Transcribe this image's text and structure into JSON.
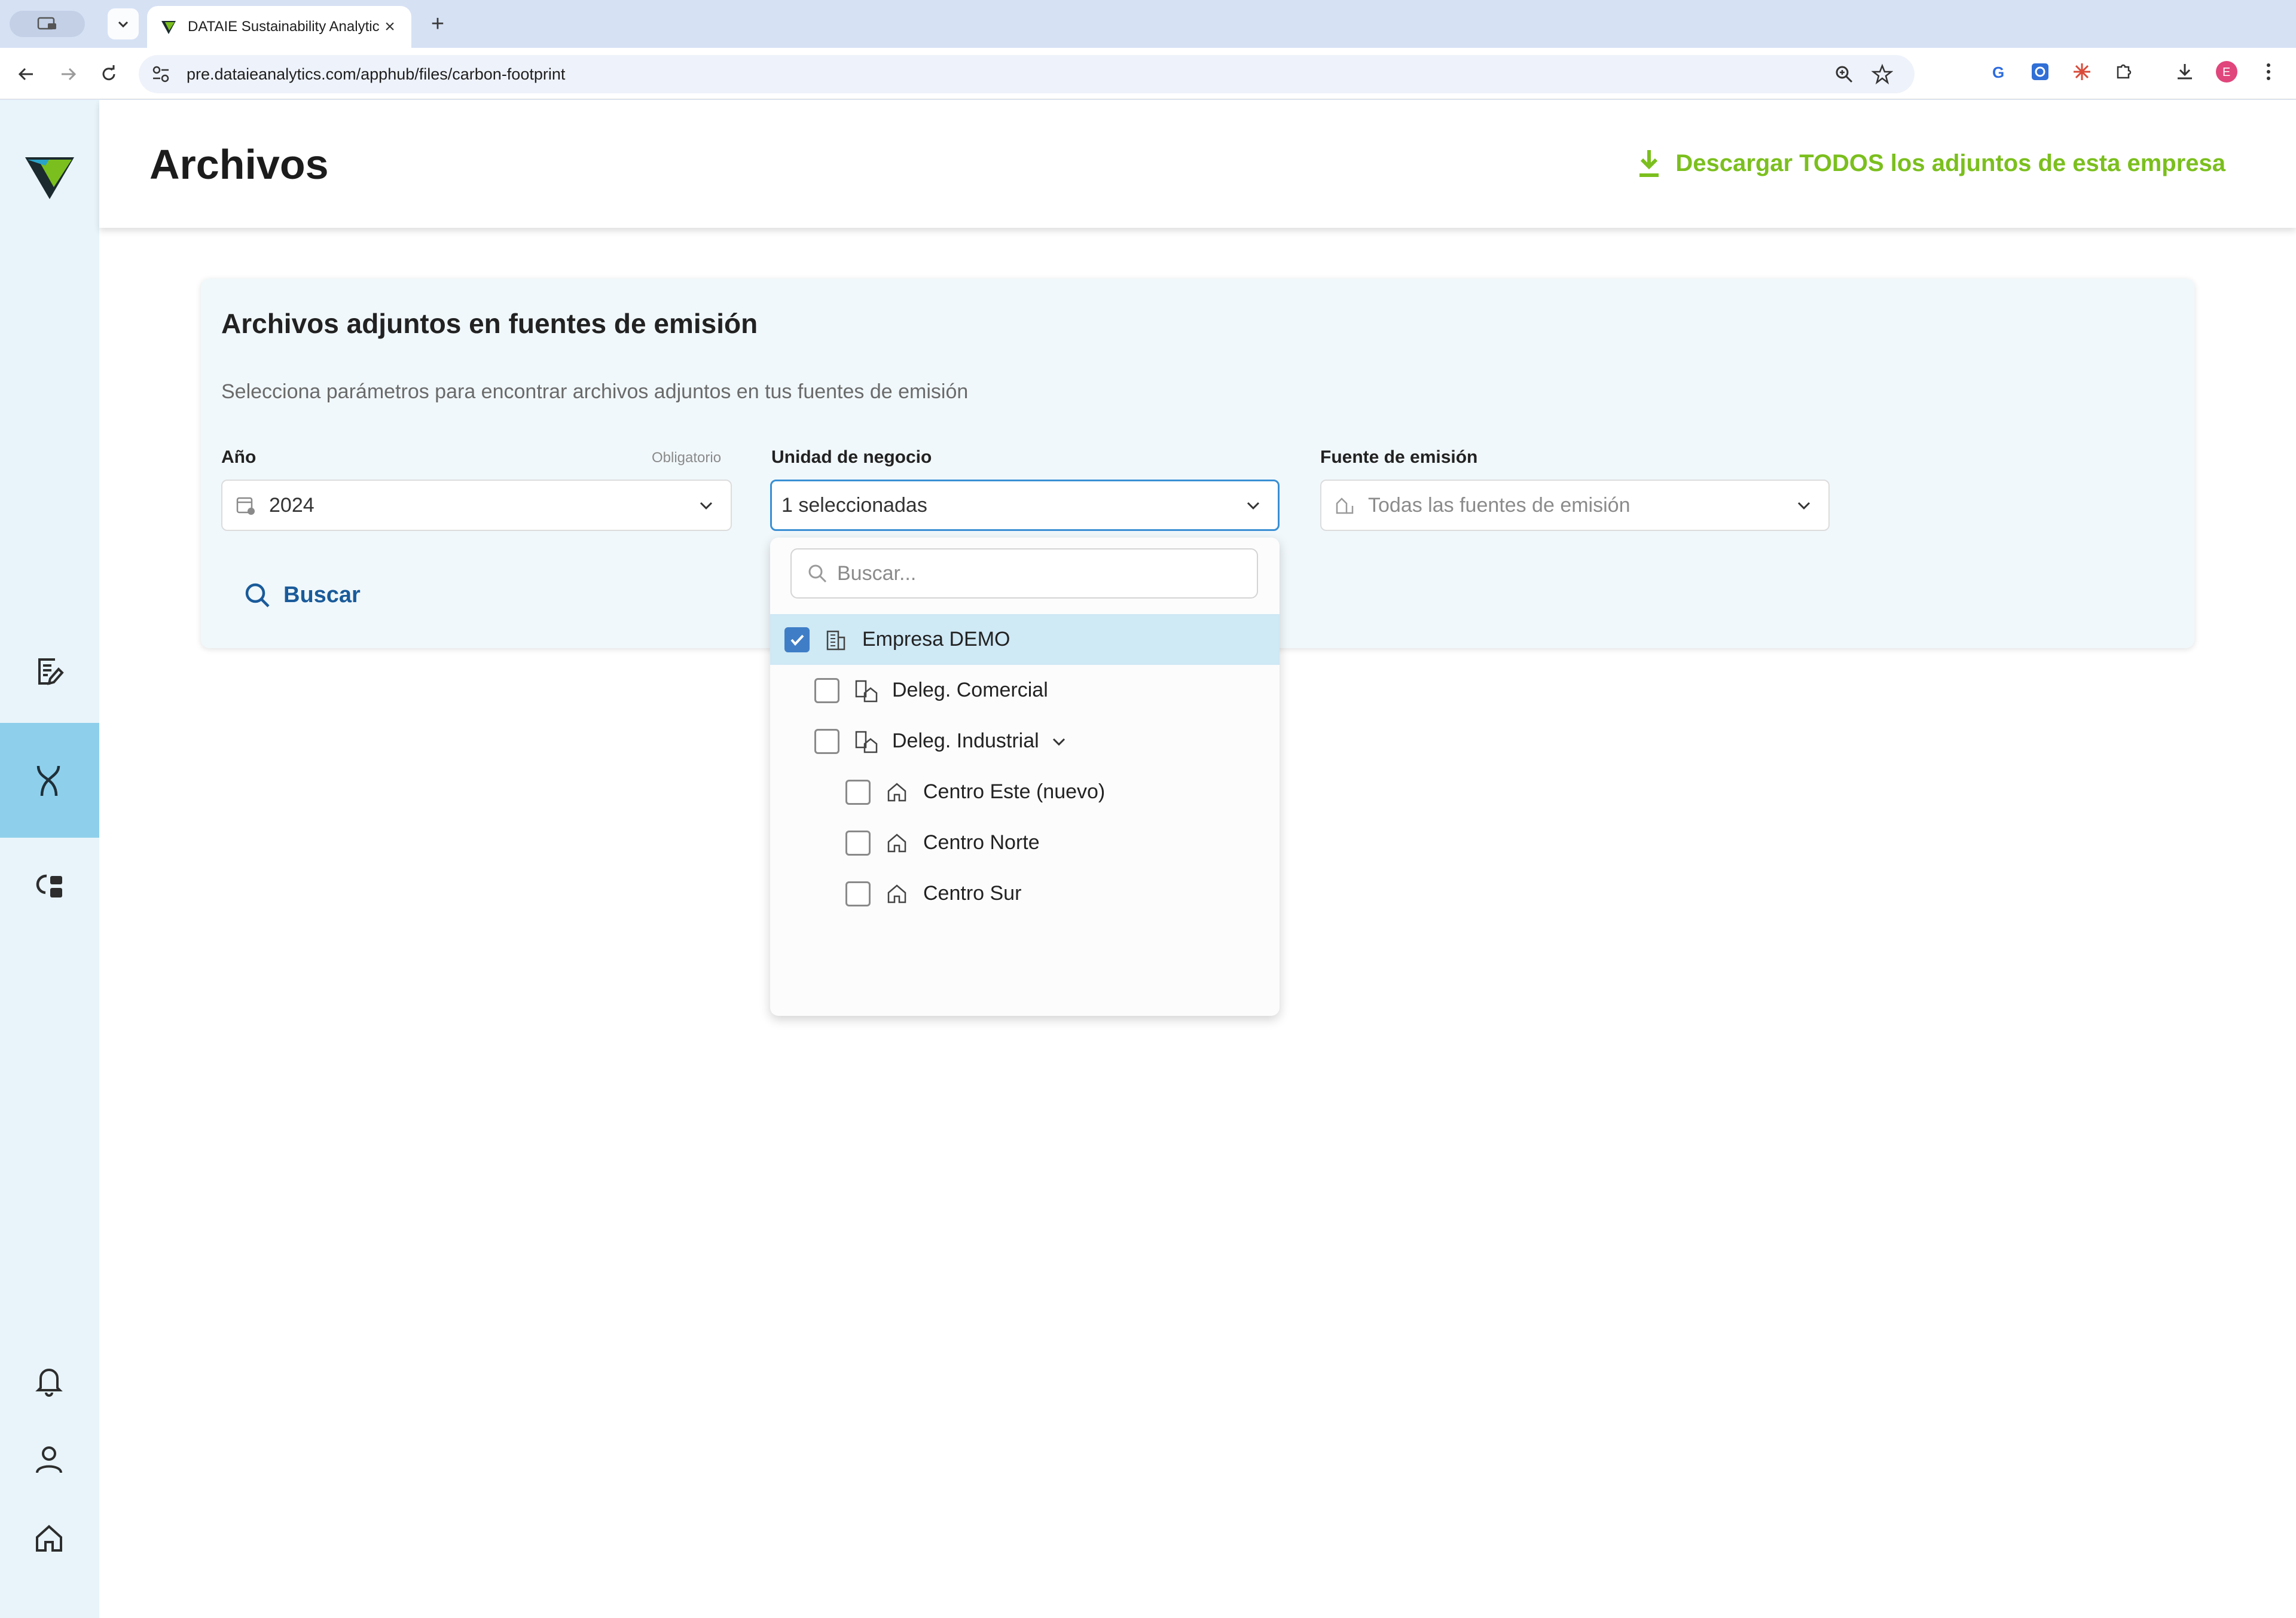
{
  "browser": {
    "tab_title": "DATAIE Sustainability Analytic",
    "new_tab": "+",
    "url": "pre.dataieanalytics.com/apphub/files/carbon-footprint",
    "profile_initial": "E"
  },
  "header": {
    "title": "Archivos",
    "download_all_label": "Descargar TODOS los adjuntos de esta empresa"
  },
  "card": {
    "title": "Archivos adjuntos en fuentes de emisión",
    "subtitle": "Selecciona parámetros para encontrar archivos adjuntos en tus fuentes de emisión",
    "fields": {
      "year": {
        "label": "Año",
        "required": "Obligatorio",
        "value": "2024"
      },
      "business_unit": {
        "label": "Unidad de negocio",
        "value": "1 seleccionadas"
      },
      "emission_source": {
        "label": "Fuente de emisión",
        "placeholder": "Todas las fuentes de emisión"
      }
    },
    "search_button": "Buscar"
  },
  "dropdown": {
    "search_placeholder": "Buscar...",
    "items": [
      {
        "label": "Empresa DEMO",
        "checked": true,
        "icon": "building-icon"
      },
      {
        "label": "Deleg. Comercial",
        "checked": false,
        "icon": "branch-icon"
      },
      {
        "label": "Deleg. Industrial",
        "checked": false,
        "icon": "branch-icon",
        "expandable": true
      },
      {
        "label": "Centro Este (nuevo)",
        "checked": false,
        "icon": "home-icon"
      },
      {
        "label": "Centro Norte",
        "checked": false,
        "icon": "home-icon"
      },
      {
        "label": "Centro Sur",
        "checked": false,
        "icon": "home-icon"
      }
    ]
  },
  "colors": {
    "accent_green": "#7bbf1e",
    "primary_blue": "#1a5b9a",
    "sidebar_bg": "#e8f4fa",
    "sidebar_active": "#8ed0ec",
    "selected_row": "#cfe9f5",
    "checkbox_checked": "#3f7ec7"
  }
}
